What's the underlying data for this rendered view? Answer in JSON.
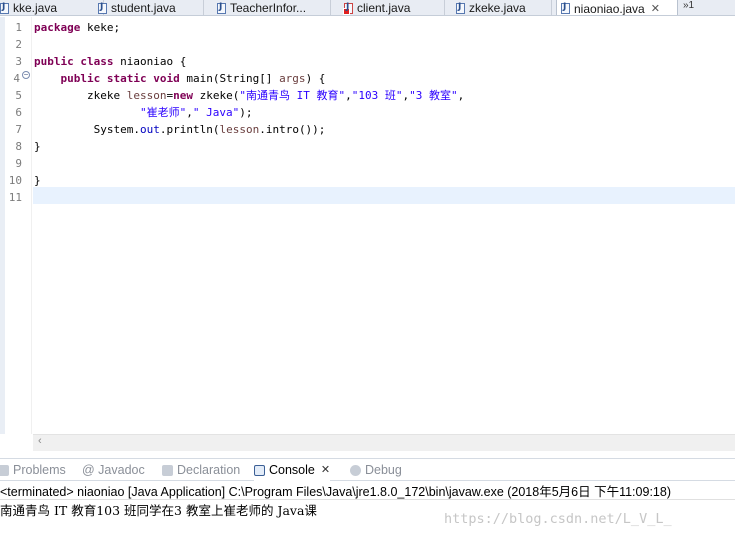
{
  "tabs": [
    {
      "label": "kke.java",
      "icon": "java-file-icon",
      "active": false
    },
    {
      "label": "student.java",
      "icon": "java-file-icon",
      "active": false
    },
    {
      "label": "TeacherInfor...",
      "icon": "java-file-icon",
      "active": false
    },
    {
      "label": "client.java",
      "icon": "java-file-error-icon",
      "active": false
    },
    {
      "label": "zkeke.java",
      "icon": "java-file-icon",
      "active": false
    },
    {
      "label": "niaoniao.java",
      "icon": "java-file-icon",
      "active": true
    }
  ],
  "tab_overflow": "»1",
  "editor": {
    "line_numbers": [
      "1",
      "2",
      "3",
      "4",
      "5",
      "6",
      "7",
      "8",
      "9",
      "10",
      "11"
    ],
    "lines": {
      "l1_kw": "package",
      "l1_rest": " keke;",
      "l3_kw": "public class",
      "l3_rest": " niaoniao {",
      "l4_kw1": "public static void",
      "l4_rest1": " main(String[] ",
      "l4_var": "args",
      "l4_rest2": ") {",
      "l5_type": "zkeke ",
      "l5_var": "lesson",
      "l5_eq": "=",
      "l5_kw": "new",
      "l5_ctor": " zkeke(",
      "l5_s1": "\"南通青鸟 IT 教育\"",
      "l5_c1": ",",
      "l5_s2": "\"103 班\"",
      "l5_c2": ",",
      "l5_s3": "\"3 教室\"",
      "l5_c3": ",",
      "l6_s1": "\"崔老师\"",
      "l6_c1": ",",
      "l6_s2": "\" Java\"",
      "l6_end": ");",
      "l7_a": "System.",
      "l7_out": "out",
      "l7_b": ".println(",
      "l7_var": "lesson",
      "l7_c": ".intro());",
      "l8": "}",
      "l10": "}"
    }
  },
  "views": [
    {
      "label": "Problems",
      "icon": "problems-icon",
      "active": false
    },
    {
      "label": "@ Javadoc",
      "icon": "javadoc-icon",
      "active": false
    },
    {
      "label": "Declaration",
      "icon": "declaration-icon",
      "active": false
    },
    {
      "label": "Console",
      "icon": "console-icon",
      "active": true
    },
    {
      "label": "Debug",
      "icon": "debug-icon",
      "active": false
    }
  ],
  "console": {
    "header": "<terminated> niaoniao [Java Application] C:\\Program Files\\Java\\jre1.8.0_172\\bin\\javaw.exe (2018年5月6日 下午11:09:18)",
    "output": "南通青鸟 IT 教育103 班同学在3 教室上崔老师的 Java课"
  },
  "watermark": "https://blog.csdn.net/L_V_L_"
}
